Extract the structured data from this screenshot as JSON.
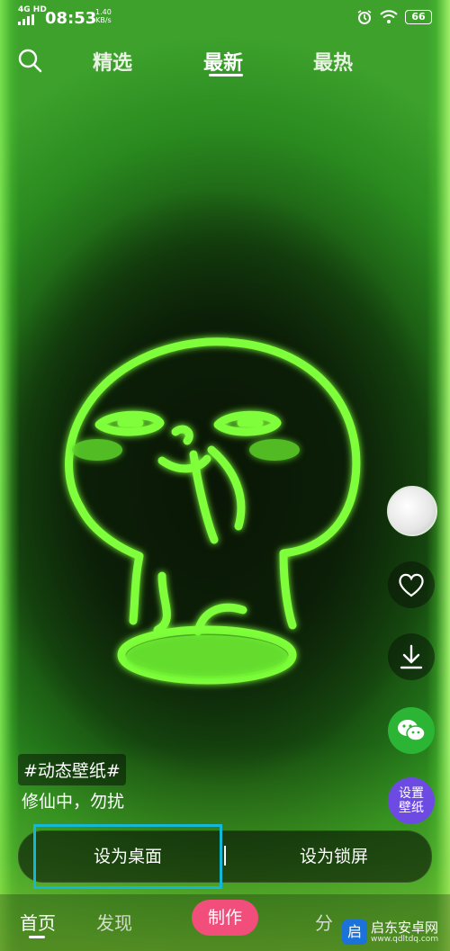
{
  "status_bar": {
    "network": "4G HD",
    "time": "08:53",
    "speed_value": "1.40",
    "speed_unit": "KB/s",
    "battery": "66"
  },
  "top_nav": {
    "tabs": [
      {
        "label": "精选",
        "active": false
      },
      {
        "label": "最新",
        "active": true
      },
      {
        "label": "最热",
        "active": false
      }
    ]
  },
  "wallpaper": {
    "hashtag": "#动态壁纸#",
    "caption": "修仙中，勿扰"
  },
  "side_actions": {
    "set_wallpaper_label_line1": "设置",
    "set_wallpaper_label_line2": "壁纸"
  },
  "set_buttons": {
    "desktop": "设为桌面",
    "lock": "设为锁屏"
  },
  "bottom_nav": {
    "home": "首页",
    "discover": "发现",
    "make": "制作",
    "share": "分"
  },
  "watermark": {
    "logo_char": "启",
    "name": "启东安卓网",
    "url": "www.qdltdq.com"
  },
  "colors": {
    "neon_green": "#7fff3a",
    "set_button_highlight": "#15b7d6",
    "make_button": "#f24e7b",
    "wechat_green": "#2cb534",
    "set_wallpaper_purple": "#6d4be3"
  }
}
